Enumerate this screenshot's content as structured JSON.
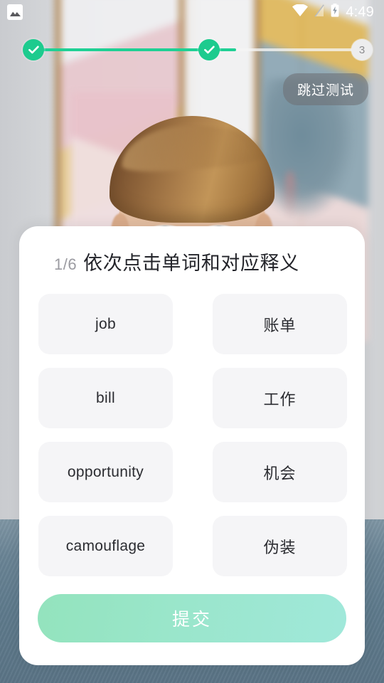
{
  "status_bar": {
    "notification_icon": "photo-icon",
    "wifi_icon": "wifi-icon",
    "signal_icon": "signal-off-icon",
    "battery_icon": "battery-charging-icon",
    "time": "4:49"
  },
  "progress": {
    "steps": [
      {
        "label": "1",
        "state": "done"
      },
      {
        "label": "2",
        "state": "done"
      },
      {
        "label": "3",
        "state": "pending"
      }
    ],
    "fill_percent": 63,
    "active_color": "#1dcb8e",
    "track_color": "#f5f5f5"
  },
  "skip": {
    "label": "跳过测试"
  },
  "card": {
    "counter": "1/6",
    "title": "依次点击单词和对应释义",
    "tiles": [
      {
        "label": "job",
        "lang": "en"
      },
      {
        "label": "账单",
        "lang": "cn"
      },
      {
        "label": "bill",
        "lang": "en"
      },
      {
        "label": "工作",
        "lang": "cn"
      },
      {
        "label": "opportunity",
        "lang": "en"
      },
      {
        "label": "机会",
        "lang": "cn"
      },
      {
        "label": "camouflage",
        "lang": "en"
      },
      {
        "label": "伪装",
        "lang": "cn"
      }
    ],
    "submit_label": "提交"
  },
  "colors": {
    "accent_green": "#1dcb8e",
    "submit_gradient_start": "#93e3bd",
    "submit_gradient_end": "#a0e8da",
    "tile_bg": "#f5f5f7",
    "card_bg": "#ffffff",
    "title_text": "#23242a",
    "counter_text": "#9b9ba1"
  }
}
